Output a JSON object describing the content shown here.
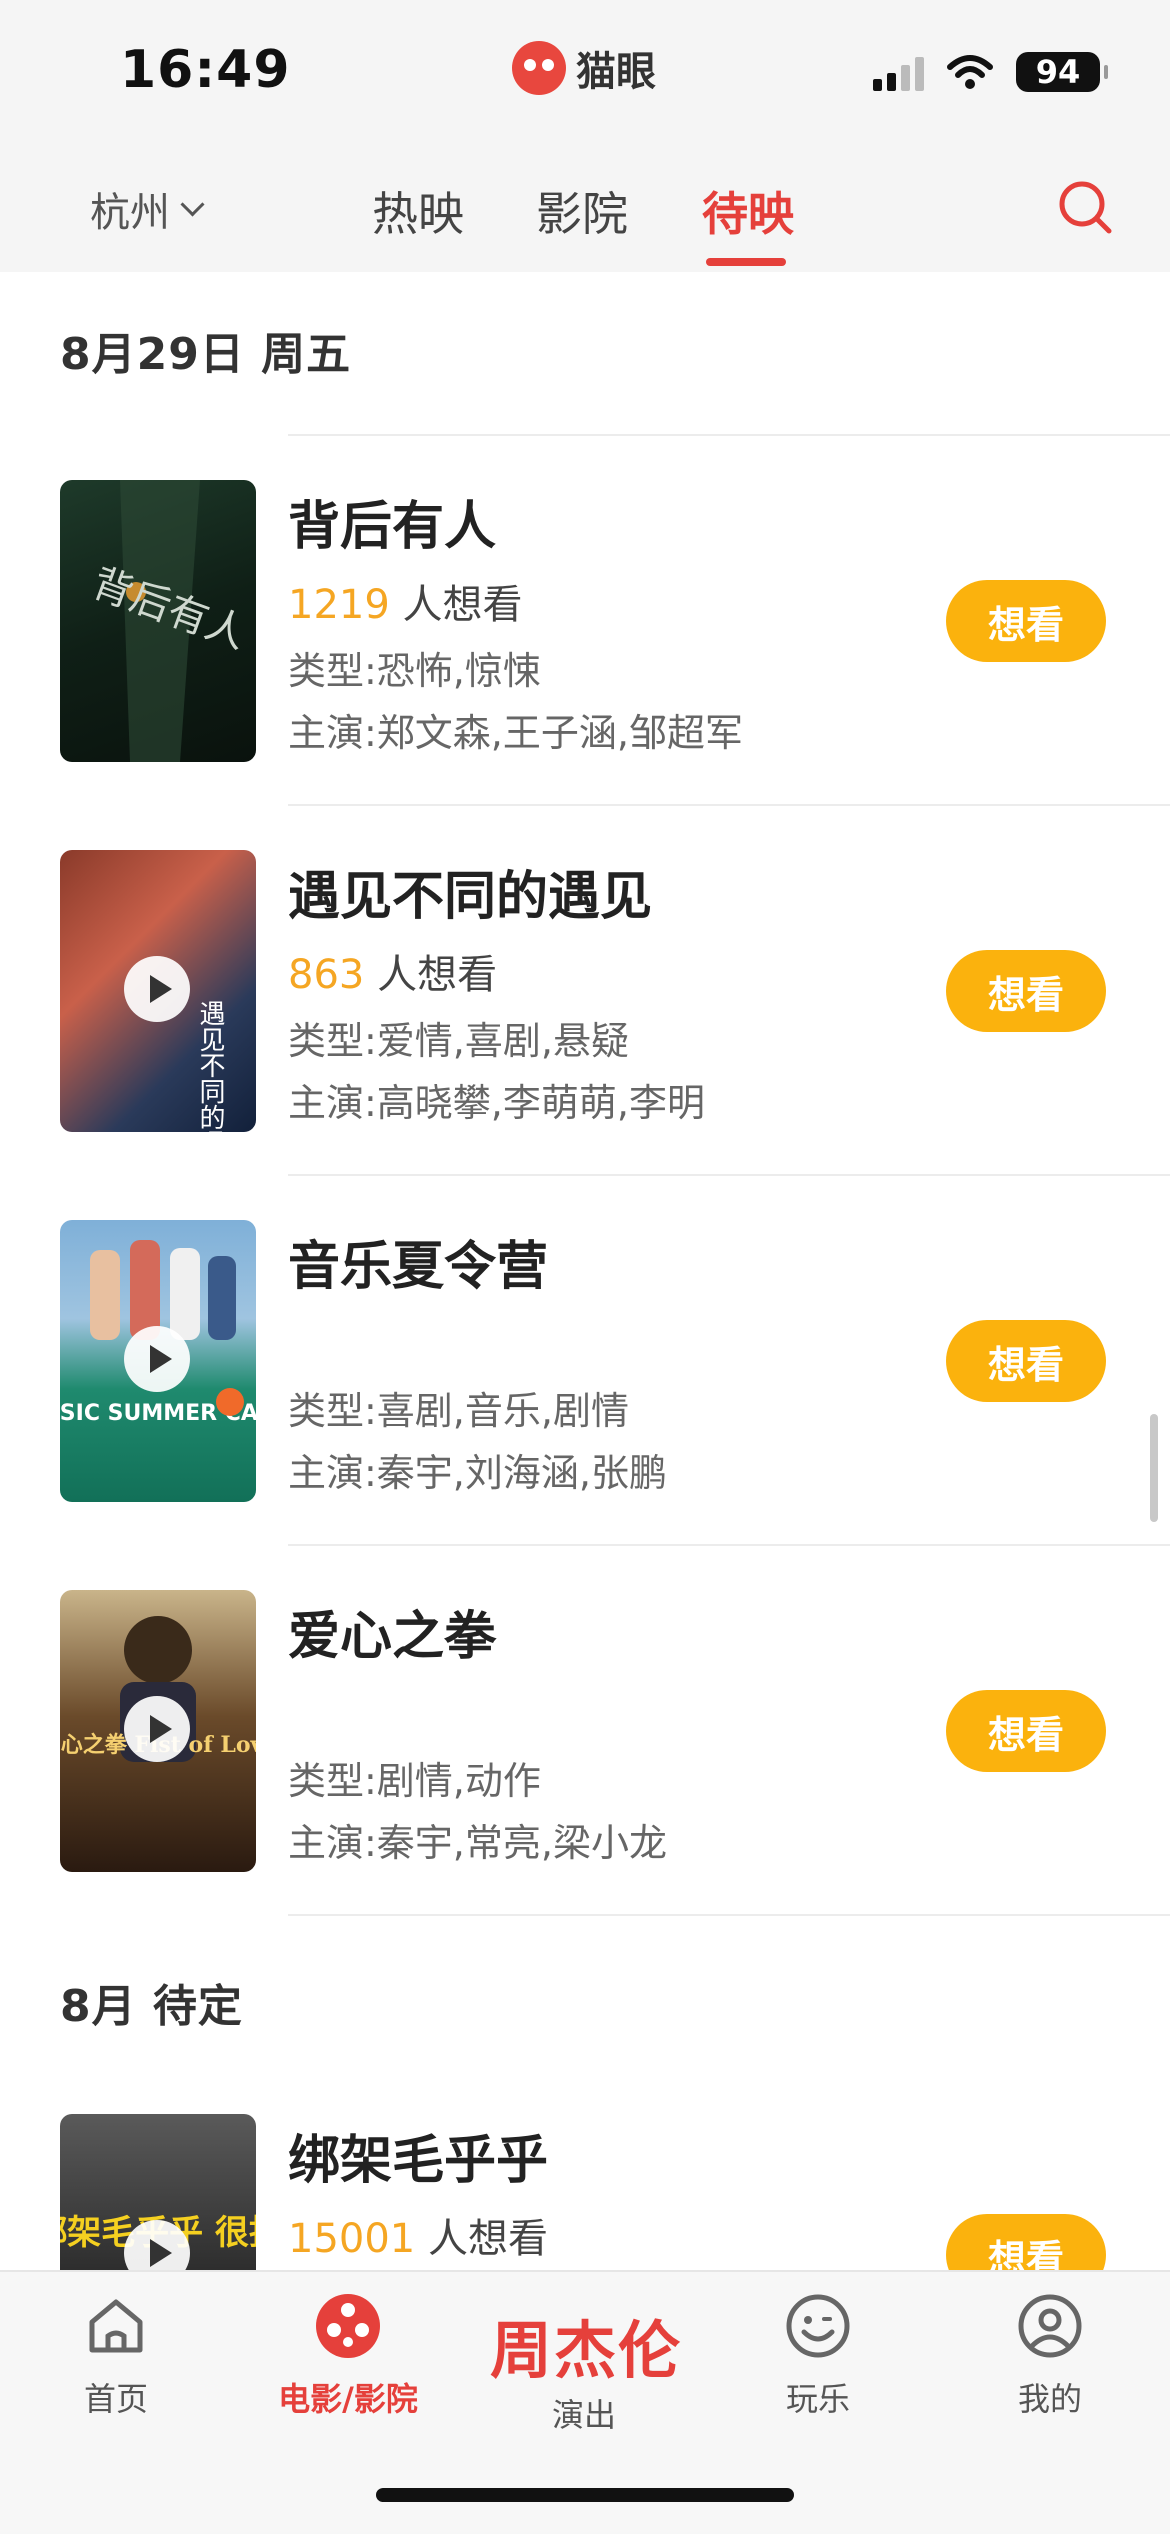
{
  "status_bar": {
    "time": "16:49",
    "battery": "94"
  },
  "brand": {
    "name": "猫眼"
  },
  "nav": {
    "city": "杭州",
    "tabs": [
      {
        "label": "热映",
        "active": false
      },
      {
        "label": "影院",
        "active": false
      },
      {
        "label": "待映",
        "active": true
      }
    ]
  },
  "sections": [
    {
      "title": "8月29日 周五"
    },
    {
      "title": "8月 待定"
    }
  ],
  "movies": [
    {
      "title": "背后有人",
      "want_count": "1219",
      "want_suffix": "人想看",
      "genre": "类型:恐怖,惊悚",
      "cast": "主演:郑文森,王子涵,邹超军",
      "button": "想看",
      "has_trailer": false
    },
    {
      "title": "遇见不同的遇见",
      "want_count": "863",
      "want_suffix": "人想看",
      "genre": "类型:爱情,喜剧,悬疑",
      "cast": "主演:高晓攀,李萌萌,李明",
      "button": "想看",
      "has_trailer": true
    },
    {
      "title": "音乐夏令营",
      "want_count": "",
      "want_suffix": "",
      "genre": "类型:喜剧,音乐,剧情",
      "cast": "主演:秦宇,刘海涵,张鹏",
      "button": "想看",
      "has_trailer": true
    },
    {
      "title": "爱心之拳",
      "want_count": "",
      "want_suffix": "",
      "genre": "类型:剧情,动作",
      "cast": "主演:秦宇,常亮,梁小龙",
      "button": "想看",
      "has_trailer": true
    },
    {
      "title": "绑架毛乎乎",
      "want_count": "15001",
      "want_suffix": "人想看",
      "genre": "",
      "cast": "",
      "button": "想看",
      "has_trailer": true
    }
  ],
  "posters": {
    "p1": {
      "text": "背后有人"
    },
    "p2": {
      "text": "遇见不同的遇见"
    },
    "p3": {
      "text": "MUSIC SUMMER CAMP"
    },
    "p4": {
      "text": "爱心之拳 Fist of Love"
    },
    "p5": {
      "text": "绑架毛乎乎 很批"
    }
  },
  "tabbar": {
    "items": [
      {
        "label": "首页",
        "icon": "home-icon",
        "active": false
      },
      {
        "label": "电影/影院",
        "icon": "film-reel-icon",
        "active": true
      },
      {
        "label": "演出",
        "promo": "周杰伦",
        "active": false
      },
      {
        "label": "玩乐",
        "icon": "smile-icon",
        "active": false
      },
      {
        "label": "我的",
        "icon": "user-icon",
        "active": false
      }
    ]
  },
  "colors": {
    "accent": "#e5403b",
    "want_button": "#fbb20d",
    "want_number": "#f5a623"
  }
}
